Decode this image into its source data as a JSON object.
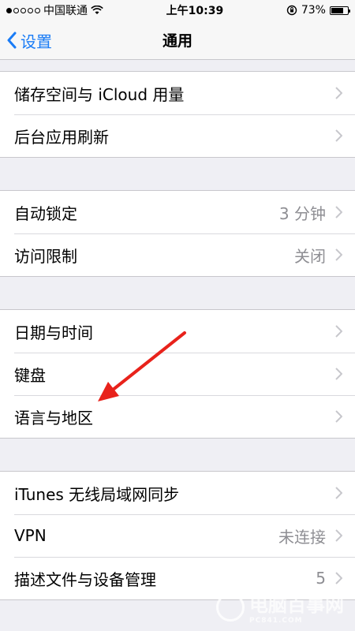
{
  "status_bar": {
    "carrier": "中国联通",
    "time": "上午10:39",
    "battery_percent": "73%",
    "battery_level": 0.73
  },
  "nav": {
    "back_label": "设置",
    "title": "通用"
  },
  "groups": [
    [
      {
        "label": "储存空间与 iCloud 用量",
        "value": ""
      },
      {
        "label": "后台应用刷新",
        "value": ""
      }
    ],
    [
      {
        "label": "自动锁定",
        "value": "3 分钟"
      },
      {
        "label": "访问限制",
        "value": "关闭"
      }
    ],
    [
      {
        "label": "日期与时间",
        "value": ""
      },
      {
        "label": "键盘",
        "value": ""
      },
      {
        "label": "语言与地区",
        "value": ""
      }
    ],
    [
      {
        "label": "iTunes 无线局域网同步",
        "value": ""
      },
      {
        "label": "VPN",
        "value": "未连接"
      },
      {
        "label": "描述文件与设备管理",
        "value": "5"
      }
    ]
  ],
  "watermark": {
    "text": "电脑百事网",
    "sub": "PC841.COM"
  },
  "colors": {
    "accent": "#1a7cf6",
    "annotation_arrow": "#e8221b",
    "background": "#efeff4"
  }
}
